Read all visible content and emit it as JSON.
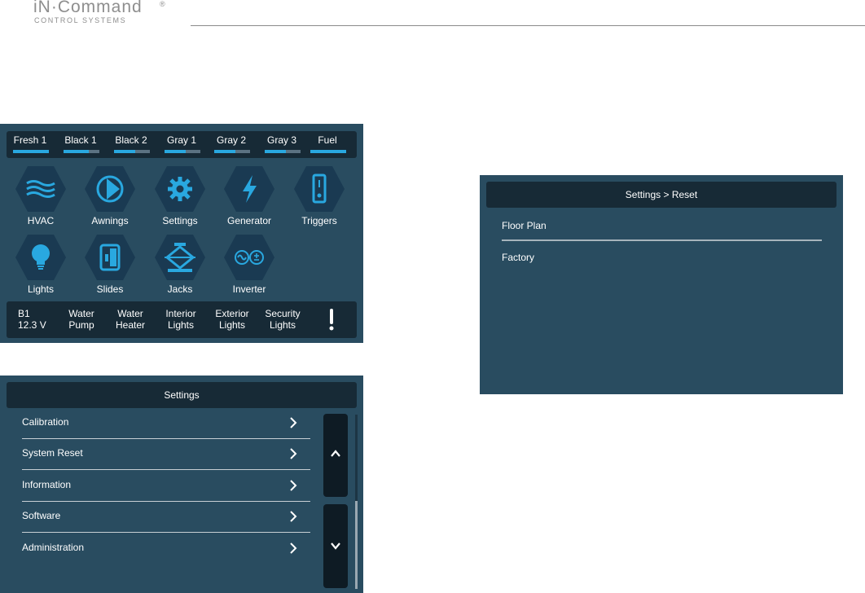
{
  "brand": {
    "name": "iN·Command",
    "reg": "®",
    "sub": "CONTROL SYSTEMS"
  },
  "home": {
    "tanks": [
      {
        "label": "Fresh 1",
        "level": 1.0
      },
      {
        "label": "Black 1",
        "level": 0.7
      },
      {
        "label": "Black 2",
        "level": 0.6
      },
      {
        "label": "Gray 1",
        "level": 0.6
      },
      {
        "label": "Gray 2",
        "level": 0.6
      },
      {
        "label": "Gray 3",
        "level": 0.6
      },
      {
        "label": "Fuel",
        "level": 1.0
      }
    ],
    "tiles": {
      "hvac": "HVAC",
      "awnings": "Awnings",
      "settings": "Settings",
      "generator": "Generator",
      "triggers": "Triggers",
      "lights": "Lights",
      "slides": "Slides",
      "jacks": "Jacks",
      "inverter": "Inverter"
    },
    "status": {
      "battery": "B1\n12.3 V",
      "water_pump": "Water\nPump",
      "water_heater": "Water\nHeater",
      "interior_lights": "Interior\nLights",
      "exterior_lights": "Exterior\nLights",
      "security_lights": "Security\nLights"
    },
    "icons": {
      "hvac": "hvac-waves-icon",
      "awnings": "awning-icon",
      "settings": "gear-icon",
      "generator": "lightning-icon",
      "triggers": "switch-icon",
      "lights": "lightbulb-icon",
      "slides": "slide-icon",
      "jacks": "jack-icon",
      "inverter": "inverter-icon",
      "alert": "exclamation-icon"
    }
  },
  "settings": {
    "title": "Settings",
    "items": [
      {
        "label": "Calibration"
      },
      {
        "label": "System Reset"
      },
      {
        "label": "Information"
      },
      {
        "label": "Software"
      },
      {
        "label": "Administration"
      }
    ]
  },
  "reset": {
    "title": "Settings > Reset",
    "items": [
      {
        "label": "Floor Plan"
      },
      {
        "label": "Factory"
      }
    ]
  },
  "colors": {
    "panel": "#294c60",
    "bar": "#172a36",
    "accent": "#29a8e0",
    "hex": "#1a3a52"
  }
}
